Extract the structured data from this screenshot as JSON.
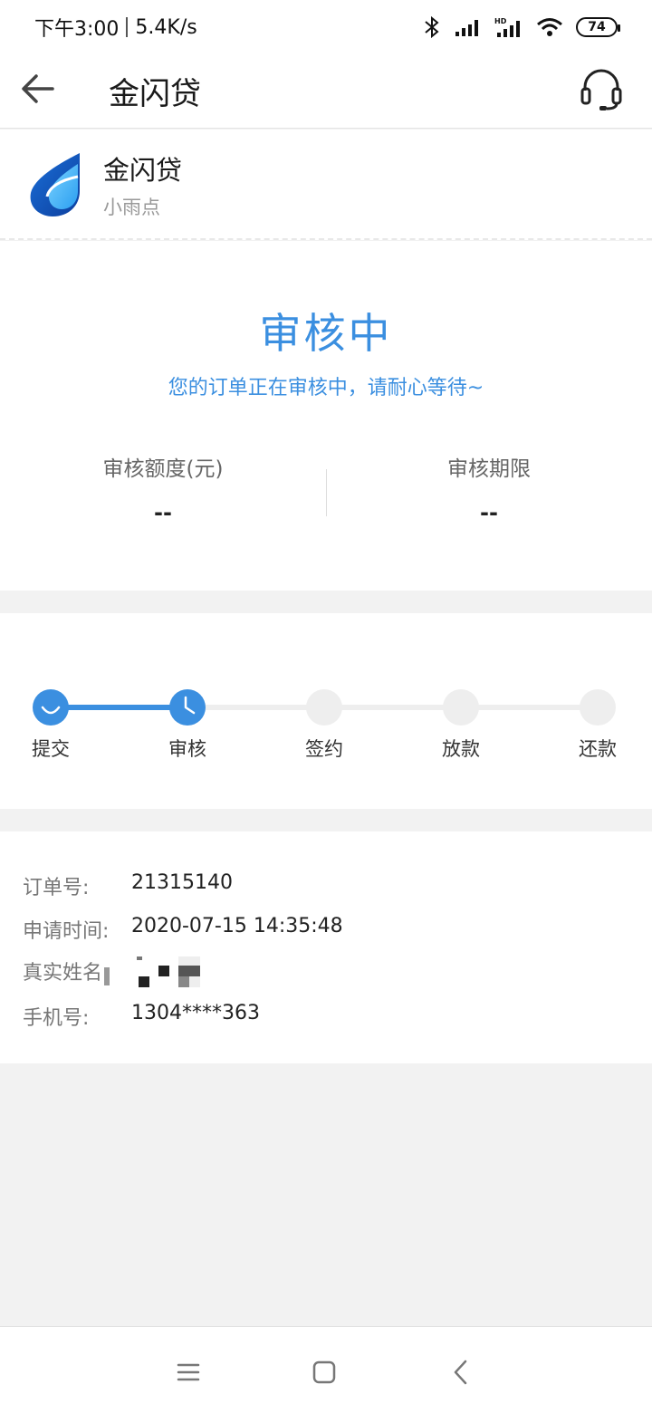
{
  "status_bar": {
    "time": "下午3:00",
    "speed": "5.4K/s",
    "battery": "74",
    "icons": [
      "bluetooth-icon",
      "signal-icon",
      "hd-signal-icon",
      "wifi-icon",
      "battery-icon"
    ]
  },
  "header": {
    "title": "金闪贷",
    "back_icon": "back-arrow-icon",
    "support_icon": "headset-icon"
  },
  "product": {
    "name": "金闪贷",
    "subtitle": "小雨点",
    "logo_icon": "drop-logo-icon"
  },
  "review": {
    "status": "审核中",
    "message": "您的订单正在审核中，请耐心等待~",
    "amount_label": "审核额度(元)",
    "amount_value": "--",
    "term_label": "审核期限",
    "term_value": "--"
  },
  "progress": {
    "steps": [
      {
        "label": "提交",
        "state": "done"
      },
      {
        "label": "审核",
        "state": "current"
      },
      {
        "label": "签约",
        "state": "pending"
      },
      {
        "label": "放款",
        "state": "pending"
      },
      {
        "label": "还款",
        "state": "pending"
      }
    ]
  },
  "order": {
    "order_no_label": "订单号:",
    "order_no": "21315140",
    "apply_time_label": "申请时间:",
    "apply_time": "2020-07-15 14:35:48",
    "name_label": "真实姓名",
    "phone_label": "手机号:",
    "phone": "1304****363"
  },
  "nav": {
    "icons": [
      "menu-icon",
      "home-icon",
      "back-icon"
    ]
  },
  "colors": {
    "accent": "#3b8fe0",
    "track": "#eeeeee",
    "background": "#f2f2f2"
  }
}
